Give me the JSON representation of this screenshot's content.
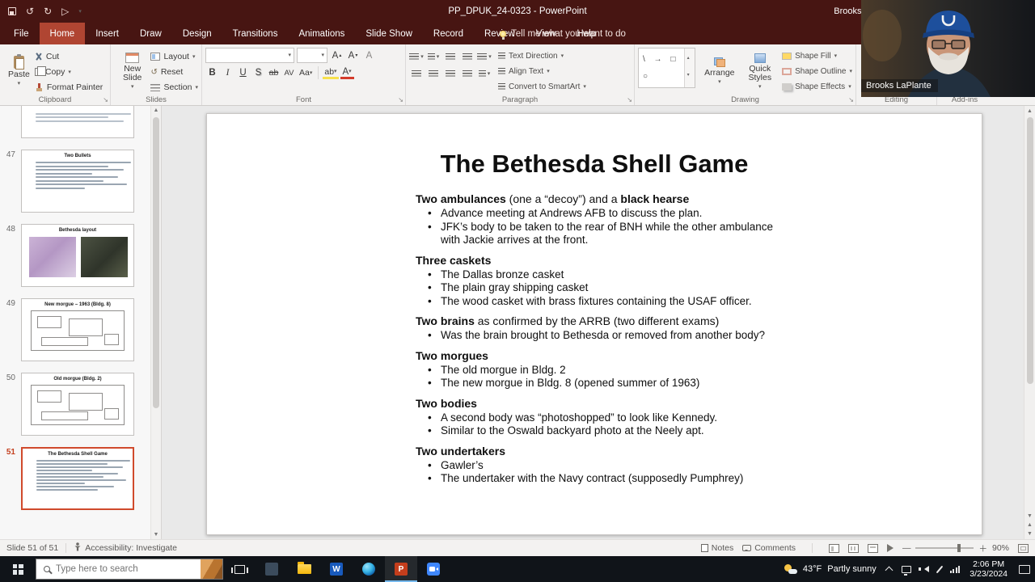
{
  "colors": {
    "titlebar": "#471512",
    "active_tab": "#b04532",
    "accent": "#c43e1c",
    "selection_border": "#d04a2c",
    "taskbar": "#101419",
    "active_app_underline": "#76b9ed"
  },
  "titlebar": {
    "title": "PP_DPUK_24-0323 - PowerPoint",
    "account": "Brooks LaPlante"
  },
  "tabs": [
    "File",
    "Home",
    "Insert",
    "Draw",
    "Design",
    "Transitions",
    "Animations",
    "Slide Show",
    "Record",
    "Review",
    "View",
    "Help"
  ],
  "active_tab": "Home",
  "tell_me": "Tell me what you want to do",
  "ribbon": {
    "clipboard": {
      "label": "Clipboard",
      "paste": "Paste",
      "cut": "Cut",
      "copy": "Copy",
      "format_painter": "Format Painter"
    },
    "slides": {
      "label": "Slides",
      "new_slide": "New Slide",
      "layout": "Layout",
      "reset": "Reset",
      "section": "Section"
    },
    "font": {
      "label": "Font"
    },
    "paragraph": {
      "label": "Paragraph",
      "text_direction": "Text Direction",
      "align_text": "Align Text",
      "smartart": "Convert to SmartArt"
    },
    "drawing": {
      "label": "Drawing",
      "arrange": "Arrange",
      "quick_styles": "Quick Styles",
      "shape_fill": "Shape Fill",
      "shape_outline": "Shape Outline",
      "shape_effects": "Shape Effects"
    },
    "editing": {
      "label": "Editing"
    },
    "addins": {
      "label": "Add-ins"
    }
  },
  "thumbnail_panel": {
    "slides": [
      {
        "number": "",
        "title": "",
        "kind": "partial",
        "selected": false
      },
      {
        "number": "47",
        "title": "Two Bullets",
        "kind": "text",
        "selected": false
      },
      {
        "number": "48",
        "title": "Bethesda layout",
        "kind": "images",
        "selected": false
      },
      {
        "number": "49",
        "title": "New morgue – 1963 (Bldg. 8)",
        "kind": "diagram",
        "selected": false
      },
      {
        "number": "50",
        "title": "Old morgue (Bldg. 2)",
        "kind": "diagram",
        "selected": false
      },
      {
        "number": "51",
        "title": "The Bethesda Shell Game",
        "kind": "text",
        "selected": true
      }
    ]
  },
  "slide": {
    "title": "The Bethesda Shell Game",
    "sections": [
      {
        "heading_parts": [
          {
            "text": "Two ambulances",
            "bold": true
          },
          {
            "text": " (one a “decoy”) and a ",
            "bold": false
          },
          {
            "text": "black hearse",
            "bold": true
          }
        ],
        "bullets": [
          "Advance meeting at Andrews AFB to discuss the plan.",
          "JFK’s body to be taken to the rear of BNH while the other ambulance with Jackie arrives at the front."
        ]
      },
      {
        "heading_parts": [
          {
            "text": "Three caskets",
            "bold": true
          }
        ],
        "bullets": [
          "The Dallas bronze casket",
          "The plain gray shipping casket",
          "The wood casket with brass fixtures containing the USAF officer."
        ]
      },
      {
        "heading_parts": [
          {
            "text": "Two brains",
            "bold": true
          },
          {
            "text": " as confirmed by the ARRB (two different exams)",
            "bold": false
          }
        ],
        "bullets": [
          "Was the brain brought to Bethesda or removed from another body?"
        ]
      },
      {
        "heading_parts": [
          {
            "text": "Two morgues",
            "bold": true
          }
        ],
        "bullets": [
          "The old morgue in Bldg. 2",
          "The new morgue in Bldg. 8 (opened summer of 1963)"
        ]
      },
      {
        "heading_parts": [
          {
            "text": "Two bodies",
            "bold": true
          }
        ],
        "bullets": [
          "A second body was “photoshopped” to look like Kennedy.",
          "Similar to the Oswald backyard photo at the Neely apt."
        ]
      },
      {
        "heading_parts": [
          {
            "text": "Two undertakers",
            "bold": true
          }
        ],
        "bullets": [
          "Gawler’s",
          "The undertaker with the Navy contract (supposedly Pumphrey)"
        ]
      }
    ]
  },
  "statusbar": {
    "slide_indicator": "Slide 51 of 51",
    "accessibility": "Accessibility: Investigate",
    "notes": "Notes",
    "comments": "Comments",
    "zoom": "90%"
  },
  "taskbar": {
    "search_placeholder": "Type here to search",
    "weather_temp": "43°F",
    "weather_condition": "Partly sunny",
    "time": "2:06 PM",
    "date": "3/23/2024"
  },
  "webcam": {
    "name": "Brooks LaPlante"
  }
}
